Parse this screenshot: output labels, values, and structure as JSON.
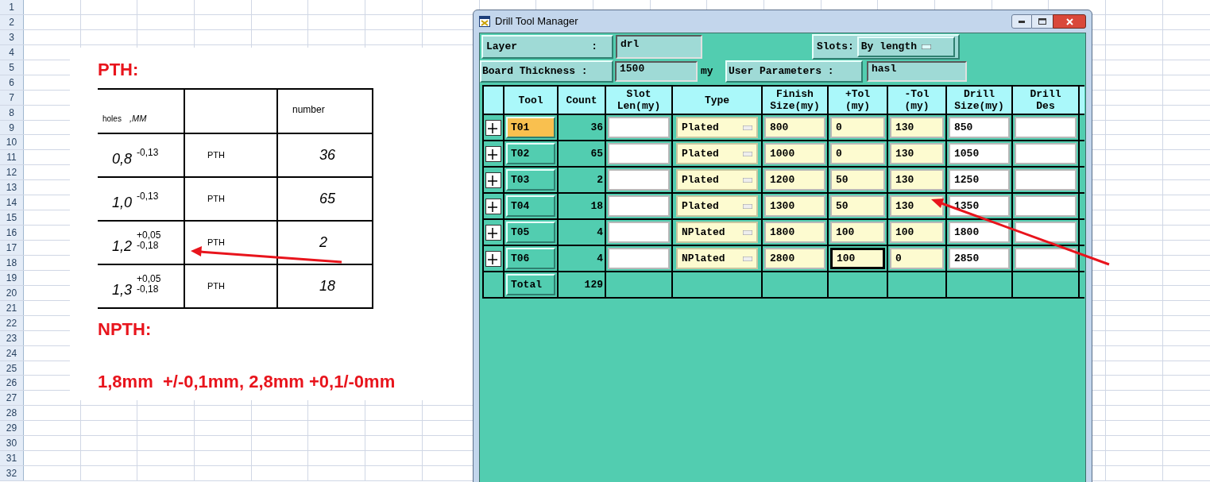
{
  "sheet": {
    "row_numbers": [
      "1",
      "2",
      "3",
      "4",
      "5",
      "6",
      "7",
      "8",
      "9",
      "10",
      "11",
      "12",
      "13",
      "14",
      "15",
      "16",
      "17",
      "18",
      "19",
      "20",
      "21",
      "22",
      "23",
      "24",
      "25",
      "26",
      "27",
      "28",
      "29",
      "30",
      "31",
      "32"
    ]
  },
  "pasted_image": {
    "pth_title": "PTH:",
    "scan_table": {
      "header": {
        "holes": "holes",
        "unit": ",MM",
        "number": "number"
      },
      "rows": [
        {
          "size": "0,8",
          "tolerance": [
            "-0,13"
          ],
          "type": "PTH",
          "number": "36"
        },
        {
          "size": "1,0",
          "tolerance": [
            "-0,13"
          ],
          "type": "PTH",
          "number": "65"
        },
        {
          "size": "1,2",
          "tolerance": [
            "+0,05",
            "-0,18"
          ],
          "type": "PTH",
          "number": "2"
        },
        {
          "size": "1,3",
          "tolerance": [
            "+0,05",
            "-0,18"
          ],
          "type": "PTH",
          "number": "18"
        }
      ]
    },
    "npth_title": "NPTH:",
    "npth_note": "1,8mm  +/-0,1mm, 2,8mm +0,1/-0mm"
  },
  "window": {
    "title": "Drill Tool Manager",
    "layer": {
      "label": "Layer",
      "colon": ":",
      "value": "drl"
    },
    "slots": {
      "label": "Slots:",
      "value": "By length"
    },
    "board_thickness": {
      "label": "Board Thickness :",
      "value": "1500",
      "unit": "my"
    },
    "user_parameters": {
      "label": "User Parameters :",
      "value": "hasl"
    },
    "columns": [
      {
        "lines": [
          "Tool"
        ]
      },
      {
        "lines": [
          "Count"
        ]
      },
      {
        "lines": [
          "Slot",
          "Len(my)"
        ]
      },
      {
        "lines": [
          "Type"
        ]
      },
      {
        "lines": [
          "Finish",
          "Size(my)"
        ]
      },
      {
        "lines": [
          "+Tol",
          "(my)"
        ]
      },
      {
        "lines": [
          "-Tol",
          "(my)"
        ]
      },
      {
        "lines": [
          "Drill",
          "Size(my)"
        ]
      },
      {
        "lines": [
          "Drill",
          "Des"
        ]
      }
    ],
    "rows": [
      {
        "tool": "T01",
        "selected": true,
        "count": "36",
        "type": "Plated",
        "finish": "800",
        "plus_tol": "0",
        "minus_tol": "130",
        "drill_size": "850",
        "focused": false
      },
      {
        "tool": "T02",
        "selected": false,
        "count": "65",
        "type": "Plated",
        "finish": "1000",
        "plus_tol": "0",
        "minus_tol": "130",
        "drill_size": "1050",
        "focused": false
      },
      {
        "tool": "T03",
        "selected": false,
        "count": "2",
        "type": "Plated",
        "finish": "1200",
        "plus_tol": "50",
        "minus_tol": "130",
        "drill_size": "1250",
        "focused": false
      },
      {
        "tool": "T04",
        "selected": false,
        "count": "18",
        "type": "Plated",
        "finish": "1300",
        "plus_tol": "50",
        "minus_tol": "130",
        "drill_size": "1350",
        "focused": false
      },
      {
        "tool": "T05",
        "selected": false,
        "count": "4",
        "type": "NPlated",
        "finish": "1800",
        "plus_tol": "100",
        "minus_tol": "100",
        "drill_size": "1800",
        "focused": false
      },
      {
        "tool": "T06",
        "selected": false,
        "count": "4",
        "type": "NPlated",
        "finish": "2800",
        "plus_tol": "100",
        "minus_tol": "0",
        "drill_size": "2850",
        "focused": true
      }
    ],
    "total": {
      "label": "Total",
      "count": "129"
    }
  }
}
